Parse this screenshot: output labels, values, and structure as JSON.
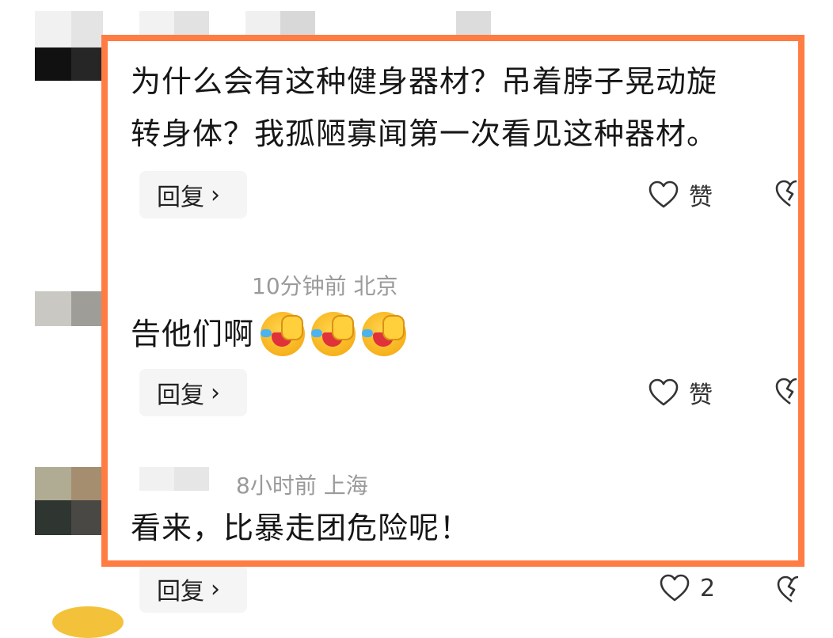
{
  "comments": [
    {
      "text_line1": "为什么会有这种健身器材？吊着脖子晃动旋",
      "text_line2": "转身体？我孤陋寡闻第一次看见这种器材。",
      "reply_label": "回复",
      "like_label": "赞"
    },
    {
      "meta": "10分钟前  北京",
      "text": "告他们啊",
      "emoji_count": 3,
      "reply_label": "回复",
      "like_label": "赞"
    },
    {
      "meta": "8小时前  上海",
      "text": "看来，比暴走团危险呢！",
      "reply_label": "回复",
      "like_count": "2"
    }
  ],
  "colors": {
    "highlight": "#ff7c43",
    "meta_text": "#9a9a9a",
    "reply_bg": "#f5f5f5"
  },
  "icons": [
    "heart-outline-icon",
    "broken-heart-icon",
    "chevron-right-icon",
    "rofl-emoji"
  ]
}
